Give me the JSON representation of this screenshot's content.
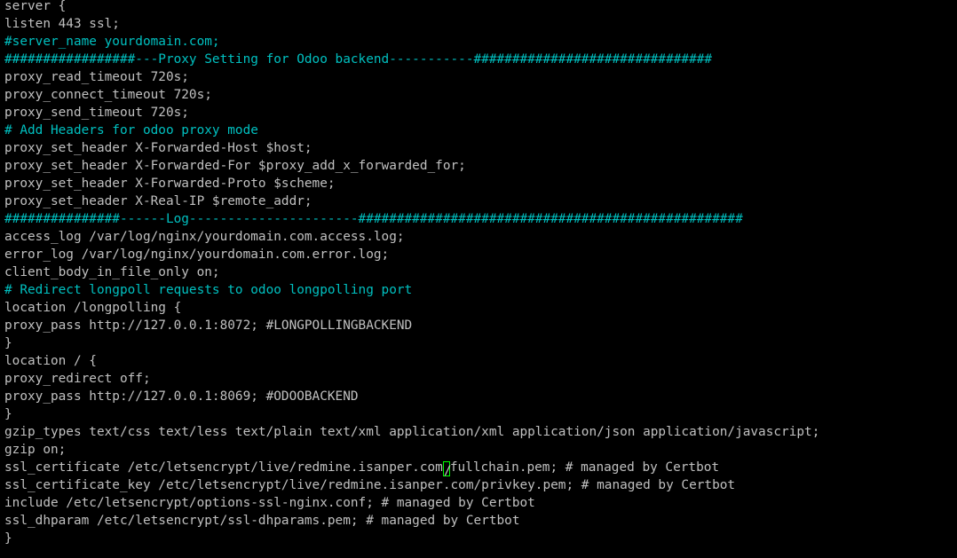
{
  "terminal": {
    "colors": {
      "background": "#000000",
      "text": "#c0c0c0",
      "comment": "#00c0c0",
      "cursor": "#00ff00"
    },
    "lines": [
      {
        "text": "server {",
        "type": "code"
      },
      {
        "text": "listen 443 ssl;",
        "type": "code"
      },
      {
        "text": "#server_name yourdomain.com;",
        "type": "comment"
      },
      {
        "text": "#################---Proxy Setting for Odoo backend-----------###############################",
        "type": "comment"
      },
      {
        "text": "proxy_read_timeout 720s;",
        "type": "code"
      },
      {
        "text": "proxy_connect_timeout 720s;",
        "type": "code"
      },
      {
        "text": "proxy_send_timeout 720s;",
        "type": "code"
      },
      {
        "text": "# Add Headers for odoo proxy mode",
        "type": "comment"
      },
      {
        "text": "proxy_set_header X-Forwarded-Host $host;",
        "type": "code"
      },
      {
        "text": "proxy_set_header X-Forwarded-For $proxy_add_x_forwarded_for;",
        "type": "code"
      },
      {
        "text": "proxy_set_header X-Forwarded-Proto $scheme;",
        "type": "code"
      },
      {
        "text": "proxy_set_header X-Real-IP $remote_addr;",
        "type": "code"
      },
      {
        "text": "###############------Log----------------------##################################################",
        "type": "comment"
      },
      {
        "text": "access_log /var/log/nginx/yourdomain.com.access.log;",
        "type": "code"
      },
      {
        "text": "error_log /var/log/nginx/yourdomain.com.error.log;",
        "type": "code"
      },
      {
        "text": "client_body_in_file_only on;",
        "type": "code"
      },
      {
        "text": "# Redirect longpoll requests to odoo longpolling port",
        "type": "comment"
      },
      {
        "text": "location /longpolling {",
        "type": "code"
      },
      {
        "text": "proxy_pass http://127.0.0.1:8072; #LONGPOLLINGBACKEND",
        "type": "code"
      },
      {
        "text": "}",
        "type": "code"
      },
      {
        "text": "location / {",
        "type": "code"
      },
      {
        "text": "proxy_redirect off;",
        "type": "code"
      },
      {
        "text": "proxy_pass http://127.0.0.1:8069; #ODOOBACKEND",
        "type": "code"
      },
      {
        "text": "}",
        "type": "code"
      },
      {
        "text": "gzip_types text/css text/less text/plain text/xml application/xml application/json application/javascript;",
        "type": "code"
      },
      {
        "text": "gzip on;",
        "type": "code"
      },
      {
        "text": "ssl_certificate_key /etc/letsencrypt/live/redmine.isanper.com/privkey.pem; # managed by Certbot",
        "type": "code"
      },
      {
        "text": "include /etc/letsencrypt/options-ssl-nginx.conf; # managed by Certbot",
        "type": "code"
      },
      {
        "text": "ssl_dhparam /etc/letsencrypt/ssl-dhparams.pem; # managed by Certbot",
        "type": "code"
      },
      {
        "text": "}",
        "type": "code"
      }
    ],
    "cursor_line": {
      "before": "ssl_certificate /etc/letsencrypt/live/redmine.isanper.com",
      "cursor_char": "/",
      "after": "fullchain.pem; # managed by Certbot"
    }
  }
}
